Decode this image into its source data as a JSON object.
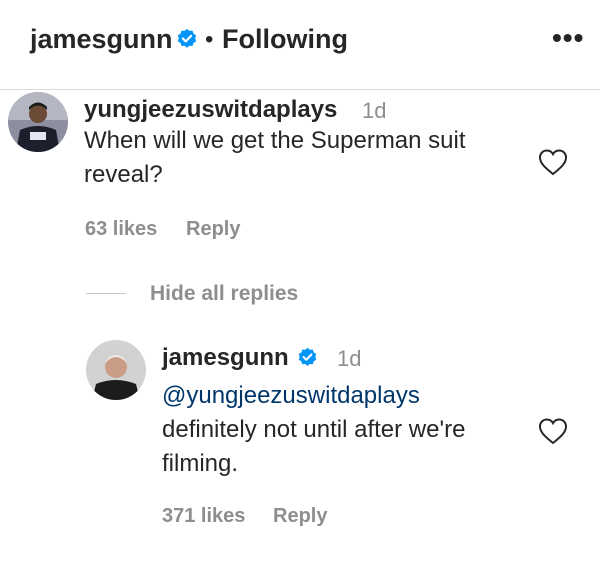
{
  "header": {
    "username": "jamesgunn",
    "separator": "•",
    "follow_status": "Following",
    "more_icon": "more-horizontal-icon",
    "more_label": "•••"
  },
  "comment": {
    "username": "yungjeezuswitdaplays",
    "time": "1d",
    "text_line1": "When will we get the Superman suit",
    "text_line2": "reveal?",
    "likes": "63 likes",
    "reply_label": "Reply",
    "like_icon": "heart-outline-icon"
  },
  "replies_toggle": {
    "label": "Hide all replies"
  },
  "reply": {
    "username": "jamesgunn",
    "time": "1d",
    "mention": "@yungjeezuswitdaplays",
    "text_line1": "definitely not until after we're",
    "text_line2": "filming.",
    "likes": "371 likes",
    "reply_label": "Reply",
    "like_icon": "heart-outline-icon"
  },
  "colors": {
    "verified_badge": "#0095f6",
    "secondary_text": "#8e8e8e",
    "mention": "#00376b"
  }
}
